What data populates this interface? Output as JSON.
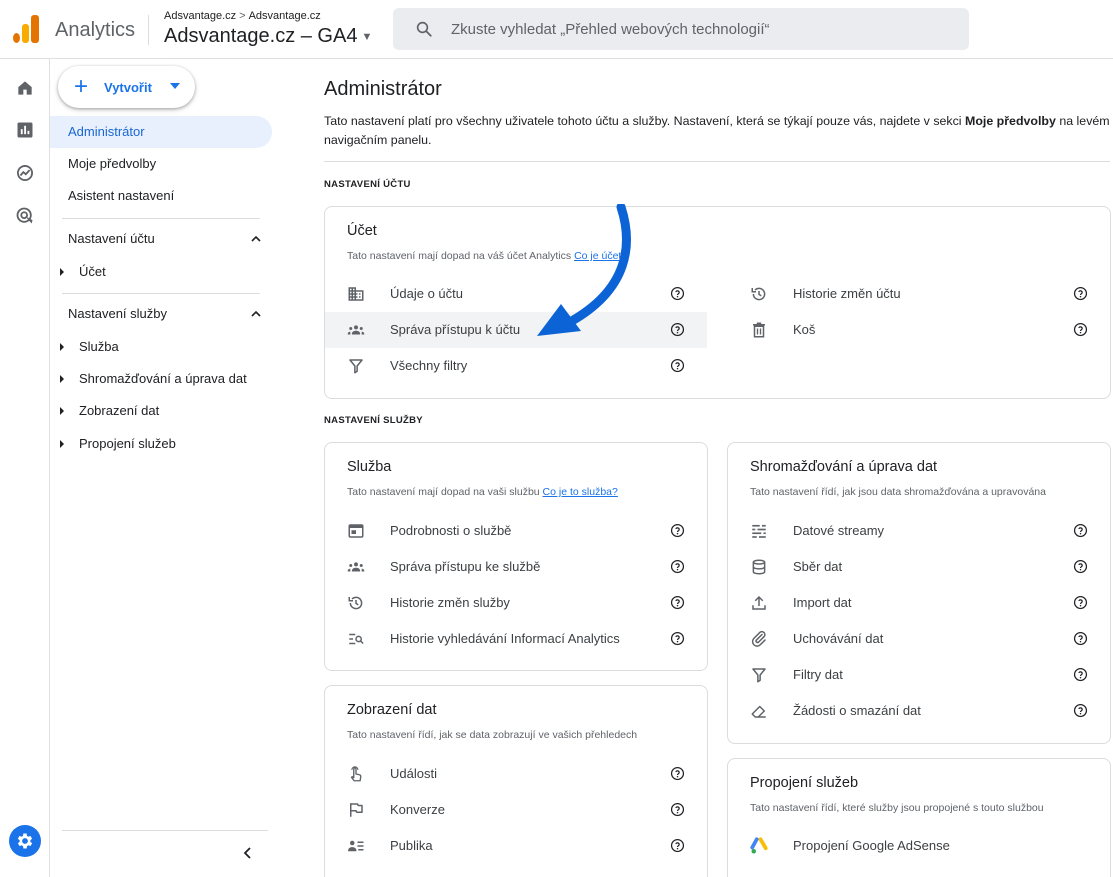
{
  "header": {
    "app_name": "Analytics",
    "breadcrumb": [
      "Adsvantage.cz",
      "Adsvantage.cz"
    ],
    "breadcrumb_sep": ">",
    "property": "Adsvantage.cz – GA4",
    "search_placeholder": "Zkuste vyhledat „Přehled webových technologií“"
  },
  "rail_icons": [
    "home-icon",
    "reports-icon",
    "explore-icon",
    "advertising-icon"
  ],
  "nav": {
    "create_label": "Vytvořit",
    "items": [
      "Administrátor",
      "Moje předvolby",
      "Asistent nastavení"
    ],
    "active_item": "Administrátor",
    "account_section": "Nastavení účtu",
    "account_children": [
      "Účet"
    ],
    "property_section": "Nastavení služby",
    "property_children": [
      "Služba",
      "Shromažďování a úprava dat",
      "Zobrazení dat",
      "Propojení služeb"
    ]
  },
  "main": {
    "title": "Administrátor",
    "desc_prefix": "Tato nastavení platí pro všechny uživatele tohoto účtu a služby. Nastavení, která se týkají pouze vás, najdete v sekci ",
    "desc_bold": "Moje předvolby",
    "desc_suffix": " na levém navigačním panelu.",
    "account_section_label": "NASTAVENÍ ÚČTU",
    "property_section_label": "NASTAVENÍ SLUŽBY"
  },
  "cards": {
    "ucet": {
      "title": "Účet",
      "subtitle": "Tato nastavení mají dopad na váš účet Analytics ",
      "link": "Co je účet?",
      "left_rows": [
        {
          "label": "Údaje o účtu",
          "icon": "building-icon"
        },
        {
          "label": "Správa přístupu k účtu",
          "icon": "group-icon"
        },
        {
          "label": "Všechny filtry",
          "icon": "filter-icon"
        }
      ],
      "right_rows": [
        {
          "label": "Historie změn účtu",
          "icon": "history-icon"
        },
        {
          "label": "Koš",
          "icon": "trash-icon"
        }
      ],
      "highlighted_row": "Správa přístupu k účtu"
    },
    "sluzba": {
      "title": "Služba",
      "subtitle": "Tato nastavení mají dopad na vaši službu ",
      "link": "Co je to služba?",
      "rows": [
        {
          "label": "Podrobnosti o službě",
          "icon": "card-icon"
        },
        {
          "label": "Správa přístupu ke službě",
          "icon": "group-icon"
        },
        {
          "label": "Historie změn služby",
          "icon": "history-icon"
        },
        {
          "label": "Historie vyhledávání Informací Analytics",
          "icon": "search-list-icon"
        }
      ]
    },
    "sber": {
      "title": "Shromažďování a úprava dat",
      "subtitle": "Tato nastavení řídí, jak jsou data shromažďována a upravována",
      "rows": [
        {
          "label": "Datové streamy",
          "icon": "streams-icon"
        },
        {
          "label": "Sběr dat",
          "icon": "database-icon"
        },
        {
          "label": "Import dat",
          "icon": "upload-icon"
        },
        {
          "label": "Uchovávání dat",
          "icon": "retention-icon"
        },
        {
          "label": "Filtry dat",
          "icon": "filter-icon"
        },
        {
          "label": "Žádosti o smazání dat",
          "icon": "eraser-icon"
        }
      ]
    },
    "zobrazeni": {
      "title": "Zobrazení dat",
      "subtitle": "Tato nastavení řídí, jak se data zobrazují ve vašich přehledech",
      "rows": [
        {
          "label": "Události",
          "icon": "touch-icon"
        },
        {
          "label": "Konverze",
          "icon": "flag-icon"
        },
        {
          "label": "Publika",
          "icon": "audience-icon"
        }
      ]
    },
    "propojeni": {
      "title": "Propojení služeb",
      "subtitle": "Tato nastavení řídí, které služby jsou propojené s touto službou",
      "rows": [
        {
          "label": "Propojení Google AdSense",
          "icon": "adsense-icon"
        }
      ]
    }
  },
  "colors": {
    "accent": "#1a73e8",
    "active_bg": "#e8f0fe",
    "highlight_row": "#f1f3f4",
    "annotation_arrow": "#0b63d6"
  }
}
